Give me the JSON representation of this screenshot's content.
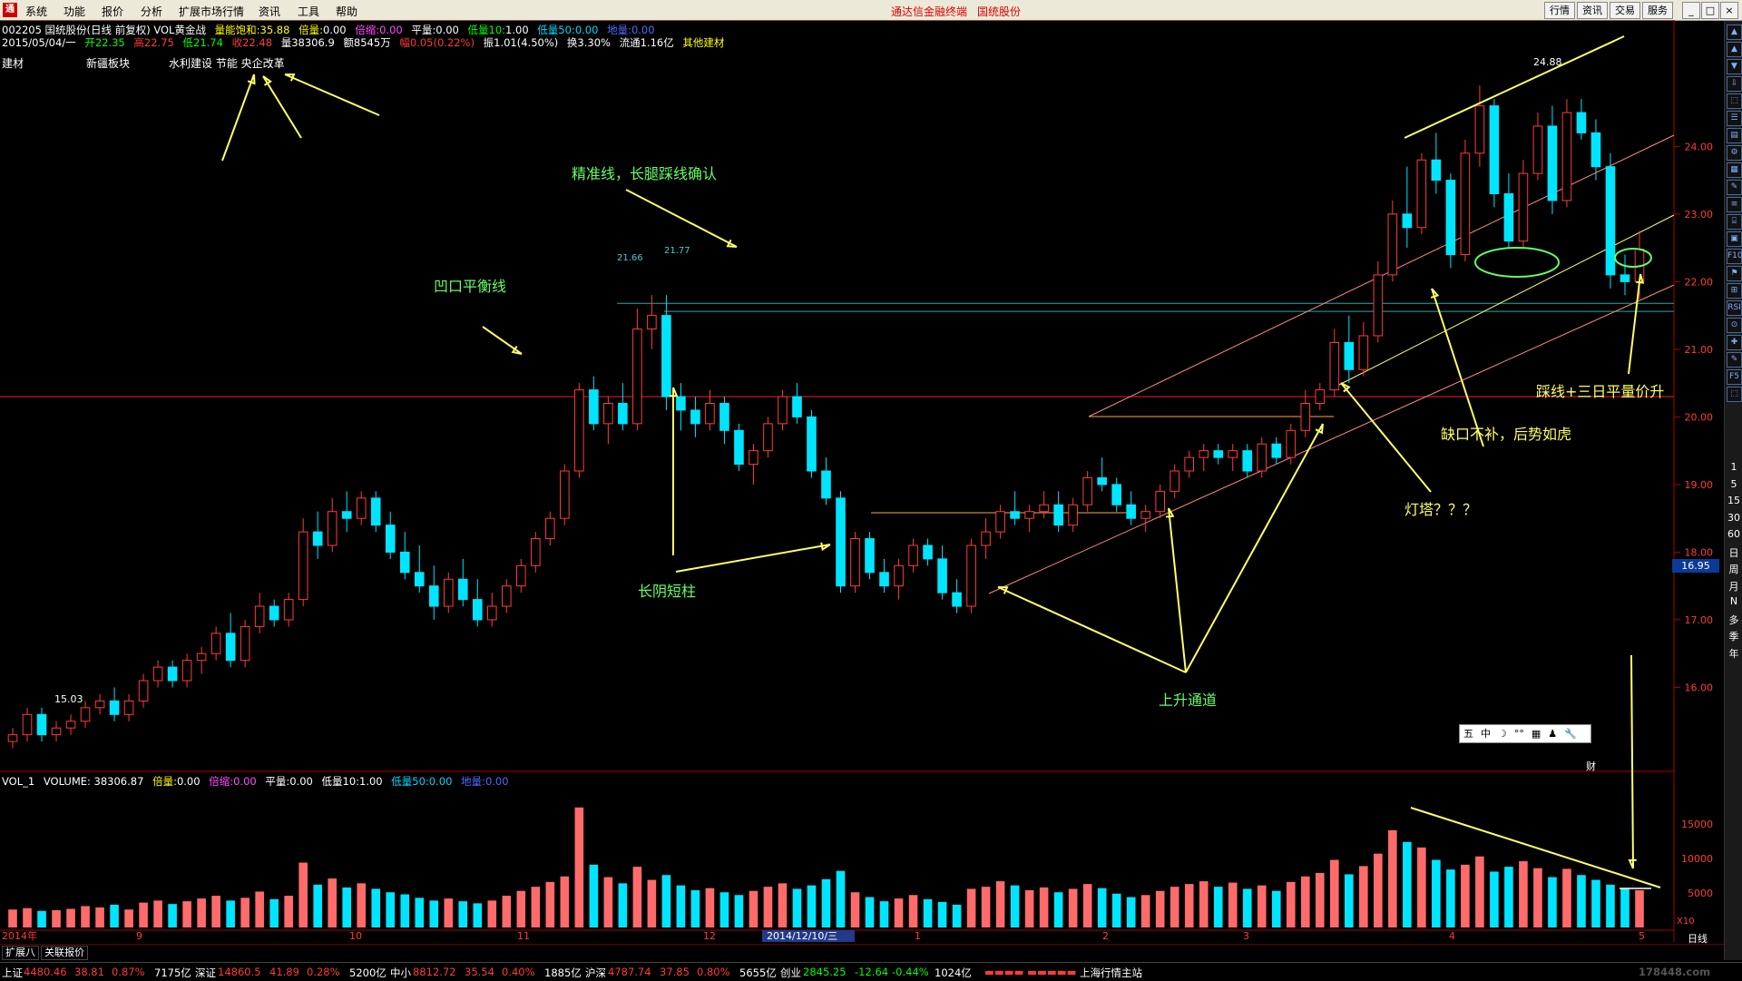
{
  "menu": {
    "logo": "通",
    "items": [
      "系统",
      "功能",
      "报价",
      "分析",
      "扩展市场行情",
      "资讯",
      "工具",
      "帮助"
    ],
    "center_links": [
      "通达信金融终端",
      "国统股份"
    ],
    "right_buttons": [
      "行情",
      "资讯",
      "交易",
      "服务"
    ],
    "window_buttons": [
      "_",
      "□",
      "×"
    ]
  },
  "header": {
    "line1": {
      "code_name": "002205 国统股份(日线 前复权) VOL黄金战",
      "f1_label": "量能饱和:",
      "f1_val": "35.88",
      "f2_label": "倍量:",
      "f2_val": "0.00",
      "f3_label": "倍缩:",
      "f3_val": "0.00",
      "f4_label": "平量:",
      "f4_val": "0.00",
      "f5_label": "低量10:",
      "f5_val": "1.00",
      "f6_label": "低量50:",
      "f6_val": "0.00",
      "f7_label": "地量:",
      "f7_val": "0.00"
    },
    "line2": {
      "date": "2015/05/04/一",
      "open": "开22.35",
      "high": "高22.75",
      "low": "低21.74",
      "close": "收22.48",
      "vol": "量38306.9",
      "amount": "额8545万",
      "change": "幅0.05(0.22%)",
      "amplitude": "振1.01(4.50%)",
      "turnover": "换3.30%",
      "float": "流通1.16亿",
      "sector": "其他建材"
    },
    "tags": [
      "建材",
      "新疆板块",
      "水利建设 节能 央企改革"
    ]
  },
  "axis": {
    "price_labels": [
      "24.00",
      "23.00",
      "22.00",
      "21.00",
      "20.00",
      "19.00",
      "18.00",
      "17.00",
      "16.00"
    ],
    "current_price": "16.95",
    "vol_labels": [
      "15000",
      "10000",
      "5000"
    ],
    "vol_unit": "X10",
    "date_labels": [
      "2014年",
      "9",
      "10",
      "11",
      "2014/12/10/三",
      "12",
      "1",
      "2",
      "3",
      "4",
      "5"
    ]
  },
  "marks": {
    "high_label": "24.88",
    "low_label": "15.03",
    "level1": "21.66",
    "level2": "21.77"
  },
  "annotations": {
    "a1": "精准线，长腿踩线确认",
    "a2": "凹口平衡线",
    "a3": "长阴短柱",
    "a4": "上升通道",
    "a5": "灯塔？？？",
    "a6": "缺口不补，后势如虎",
    "a7": "踩线+三日平量价升"
  },
  "volume_header": {
    "name": "VOL_1",
    "volume": "VOLUME: 38306.87",
    "f1_label": "倍量:",
    "f1_val": "0.00",
    "f2_label": "倍缩:",
    "f2_val": "0.00",
    "f3_label": "平量:",
    "f3_val": "0.00",
    "f4_label": "低量10:",
    "f4_val": "1.00",
    "f5_label": "低量50:",
    "f5_val": "0.00",
    "f6_label": "地量:",
    "f6_val": "0.00"
  },
  "toolbox": [
    "五",
    "中",
    "☽",
    "°°",
    "▦",
    "♟",
    "🔧"
  ],
  "finance_tag": "财",
  "right_panel": {
    "icons": [
      "▲",
      "▲",
      "▼",
      "⇩",
      "⬚",
      "☰",
      "▤",
      "⚙",
      "▦",
      "✎",
      "≡",
      "⌸",
      "▣",
      "F10",
      "⚑",
      "⊞",
      "RSI",
      "⊙",
      "✚",
      "✎",
      "F5",
      "⬚"
    ],
    "periods": [
      "1",
      "5",
      "15",
      "30",
      "60",
      "日",
      "周",
      "月",
      "N",
      "多",
      "季",
      "年"
    ],
    "bottom": "日线"
  },
  "bottom_tabs": [
    "扩展八",
    "关联报价"
  ],
  "status": {
    "sh": "上证",
    "sh_val": "4480.46",
    "sh_chg": "38.81",
    "sh_pct": "0.87%",
    "sh_amt": "7175亿",
    "sz": "深证",
    "sz_val": "14860.5",
    "sz_chg": "41.89",
    "sz_pct": "0.28%",
    "sz_amt": "5200亿",
    "zx": "中小",
    "zx_val": "8812.72",
    "zx_chg": "35.54",
    "zx_pct": "0.40%",
    "zx_amt": "1885亿",
    "hs": "沪深",
    "hs_val": "4787.74",
    "hs_chg": "37.85",
    "hs_pct": "0.80%",
    "hs_amt": "5655亿",
    "cy": "创业",
    "cy_val": "2845.25",
    "cy_chg": "-12.64",
    "cy_pct": "-0.44%",
    "cy_amt": "1024亿",
    "station": "上海行情主站",
    "watermark": "178448.com"
  },
  "chart_data": {
    "type": "candlestick",
    "title": "002205 国统股份(日线 前复权)",
    "ylim": [
      15.0,
      25.4
    ],
    "candles": [
      [
        15.2,
        15.4,
        15.1,
        15.3
      ],
      [
        15.3,
        15.7,
        15.2,
        15.6
      ],
      [
        15.6,
        15.7,
        15.2,
        15.3
      ],
      [
        15.3,
        15.5,
        15.2,
        15.4
      ],
      [
        15.4,
        15.6,
        15.3,
        15.5
      ],
      [
        15.5,
        15.8,
        15.4,
        15.7
      ],
      [
        15.7,
        15.9,
        15.6,
        15.8
      ],
      [
        15.8,
        16.0,
        15.5,
        15.6
      ],
      [
        15.6,
        15.9,
        15.5,
        15.8
      ],
      [
        15.8,
        16.2,
        15.7,
        16.1
      ],
      [
        16.1,
        16.4,
        16.0,
        16.3
      ],
      [
        16.3,
        16.4,
        16.0,
        16.1
      ],
      [
        16.1,
        16.5,
        16.0,
        16.4
      ],
      [
        16.4,
        16.6,
        16.2,
        16.5
      ],
      [
        16.5,
        16.9,
        16.4,
        16.8
      ],
      [
        16.8,
        17.1,
        16.3,
        16.4
      ],
      [
        16.4,
        17.0,
        16.3,
        16.9
      ],
      [
        16.9,
        17.4,
        16.8,
        17.2
      ],
      [
        17.2,
        17.3,
        16.9,
        17.0
      ],
      [
        17.0,
        17.4,
        16.9,
        17.3
      ],
      [
        17.3,
        18.5,
        17.2,
        18.3
      ],
      [
        18.3,
        18.6,
        17.9,
        18.1
      ],
      [
        18.1,
        18.8,
        18.0,
        18.6
      ],
      [
        18.6,
        18.9,
        18.3,
        18.5
      ],
      [
        18.5,
        18.9,
        18.4,
        18.8
      ],
      [
        18.8,
        18.9,
        18.3,
        18.4
      ],
      [
        18.4,
        18.6,
        17.9,
        18.0
      ],
      [
        18.0,
        18.3,
        17.6,
        17.7
      ],
      [
        17.7,
        18.1,
        17.4,
        17.5
      ],
      [
        17.5,
        17.8,
        17.0,
        17.2
      ],
      [
        17.2,
        17.7,
        17.1,
        17.6
      ],
      [
        17.6,
        17.9,
        17.2,
        17.3
      ],
      [
        17.3,
        17.6,
        16.9,
        17.0
      ],
      [
        17.0,
        17.4,
        16.9,
        17.2
      ],
      [
        17.2,
        17.6,
        17.1,
        17.5
      ],
      [
        17.5,
        17.9,
        17.4,
        17.8
      ],
      [
        17.8,
        18.3,
        17.7,
        18.2
      ],
      [
        18.2,
        18.6,
        18.1,
        18.5
      ],
      [
        18.5,
        19.3,
        18.4,
        19.2
      ],
      [
        19.2,
        20.5,
        19.1,
        20.4
      ],
      [
        20.4,
        20.6,
        19.8,
        19.9
      ],
      [
        19.9,
        20.3,
        19.6,
        20.2
      ],
      [
        20.2,
        20.5,
        19.8,
        19.9
      ],
      [
        19.9,
        21.6,
        19.8,
        21.3
      ],
      [
        21.3,
        21.8,
        21.0,
        21.5
      ],
      [
        21.5,
        21.8,
        20.1,
        20.3
      ],
      [
        20.3,
        20.5,
        19.8,
        20.1
      ],
      [
        20.1,
        20.3,
        19.7,
        19.9
      ],
      [
        19.9,
        20.4,
        19.8,
        20.2
      ],
      [
        20.2,
        20.3,
        19.6,
        19.8
      ],
      [
        19.8,
        19.9,
        19.2,
        19.3
      ],
      [
        19.3,
        19.6,
        19.0,
        19.5
      ],
      [
        19.5,
        20.0,
        19.4,
        19.9
      ],
      [
        19.9,
        20.4,
        19.8,
        20.3
      ],
      [
        20.3,
        20.5,
        19.9,
        20.0
      ],
      [
        20.0,
        20.1,
        19.1,
        19.2
      ],
      [
        19.2,
        19.4,
        18.7,
        18.8
      ],
      [
        18.8,
        18.9,
        17.4,
        17.5
      ],
      [
        17.5,
        18.3,
        17.4,
        18.2
      ],
      [
        18.2,
        18.3,
        17.6,
        17.7
      ],
      [
        17.7,
        17.9,
        17.4,
        17.5
      ],
      [
        17.5,
        17.9,
        17.3,
        17.8
      ],
      [
        17.8,
        18.2,
        17.7,
        18.1
      ],
      [
        18.1,
        18.2,
        17.8,
        17.9
      ],
      [
        17.9,
        18.1,
        17.3,
        17.4
      ],
      [
        17.4,
        17.6,
        17.1,
        17.2
      ],
      [
        17.2,
        18.2,
        17.1,
        18.1
      ],
      [
        18.1,
        18.5,
        17.9,
        18.3
      ],
      [
        18.3,
        18.7,
        18.2,
        18.6
      ],
      [
        18.6,
        18.9,
        18.4,
        18.5
      ],
      [
        18.5,
        18.7,
        18.3,
        18.6
      ],
      [
        18.6,
        18.9,
        18.5,
        18.7
      ],
      [
        18.7,
        18.9,
        18.3,
        18.4
      ],
      [
        18.4,
        18.8,
        18.3,
        18.7
      ],
      [
        18.7,
        19.2,
        18.6,
        19.1
      ],
      [
        19.1,
        19.4,
        18.9,
        19.0
      ],
      [
        19.0,
        19.1,
        18.6,
        18.7
      ],
      [
        18.7,
        18.9,
        18.4,
        18.5
      ],
      [
        18.5,
        18.7,
        18.3,
        18.6
      ],
      [
        18.6,
        19.0,
        18.5,
        18.9
      ],
      [
        18.9,
        19.3,
        18.8,
        19.2
      ],
      [
        19.2,
        19.5,
        19.1,
        19.4
      ],
      [
        19.4,
        19.6,
        19.2,
        19.5
      ],
      [
        19.5,
        19.6,
        19.3,
        19.4
      ],
      [
        19.4,
        19.6,
        19.2,
        19.5
      ],
      [
        19.5,
        19.6,
        19.1,
        19.2
      ],
      [
        19.2,
        19.7,
        19.1,
        19.6
      ],
      [
        19.6,
        19.7,
        19.3,
        19.4
      ],
      [
        19.4,
        19.9,
        19.3,
        19.8
      ],
      [
        19.8,
        20.4,
        19.7,
        20.2
      ],
      [
        20.2,
        20.5,
        20.1,
        20.4
      ],
      [
        20.4,
        21.3,
        20.3,
        21.1
      ],
      [
        21.1,
        21.5,
        20.5,
        20.7
      ],
      [
        20.7,
        21.4,
        20.6,
        21.2
      ],
      [
        21.2,
        22.3,
        21.1,
        22.1
      ],
      [
        22.1,
        23.2,
        22.0,
        23.0
      ],
      [
        23.0,
        23.7,
        22.5,
        22.8
      ],
      [
        22.8,
        23.9,
        22.7,
        23.8
      ],
      [
        23.8,
        24.2,
        23.3,
        23.5
      ],
      [
        23.5,
        23.6,
        22.2,
        22.4
      ],
      [
        22.4,
        24.1,
        22.3,
        23.9
      ],
      [
        23.9,
        24.9,
        23.7,
        24.6
      ],
      [
        24.6,
        24.7,
        23.1,
        23.3
      ],
      [
        23.3,
        23.6,
        22.5,
        22.6
      ],
      [
        22.6,
        23.8,
        22.5,
        23.6
      ],
      [
        23.6,
        24.5,
        23.5,
        24.3
      ],
      [
        24.3,
        24.6,
        23.0,
        23.2
      ],
      [
        23.2,
        24.7,
        23.1,
        24.5
      ],
      [
        24.5,
        24.7,
        24.1,
        24.2
      ],
      [
        24.2,
        24.4,
        23.5,
        23.7
      ],
      [
        23.7,
        23.9,
        21.9,
        22.1
      ],
      [
        22.1,
        22.4,
        21.8,
        22.0
      ],
      [
        22.0,
        22.75,
        21.74,
        22.48
      ]
    ],
    "volumes": [
      2600,
      2800,
      2400,
      2500,
      2700,
      3100,
      2900,
      3300,
      2600,
      3600,
      3900,
      3400,
      3800,
      4200,
      4600,
      3900,
      4300,
      5200,
      4100,
      4600,
      9400,
      6200,
      7100,
      5800,
      6400,
      5600,
      5100,
      4800,
      4300,
      3900,
      4200,
      3800,
      3500,
      3900,
      4600,
      5300,
      5900,
      6600,
      7400,
      17400,
      9100,
      7300,
      6400,
      8800,
      6900,
      7600,
      6100,
      5400,
      5700,
      5100,
      4700,
      5300,
      5900,
      6400,
      5600,
      6100,
      7000,
      8200,
      5100,
      4400,
      3800,
      4200,
      4700,
      4100,
      3700,
      3300,
      5600,
      5900,
      6700,
      6100,
      5400,
      5800,
      5100,
      5600,
      6300,
      5700,
      4900,
      4400,
      4700,
      5300,
      5900,
      6300,
      6700,
      5900,
      6500,
      5600,
      6100,
      5300,
      6600,
      7400,
      7900,
      9800,
      7700,
      8900,
      10700,
      14100,
      12400,
      11600,
      9800,
      8400,
      9100,
      10300,
      8100,
      8800,
      9600,
      8600,
      7300,
      8500,
      7600,
      6900,
      6200,
      5700,
      5400
    ]
  }
}
